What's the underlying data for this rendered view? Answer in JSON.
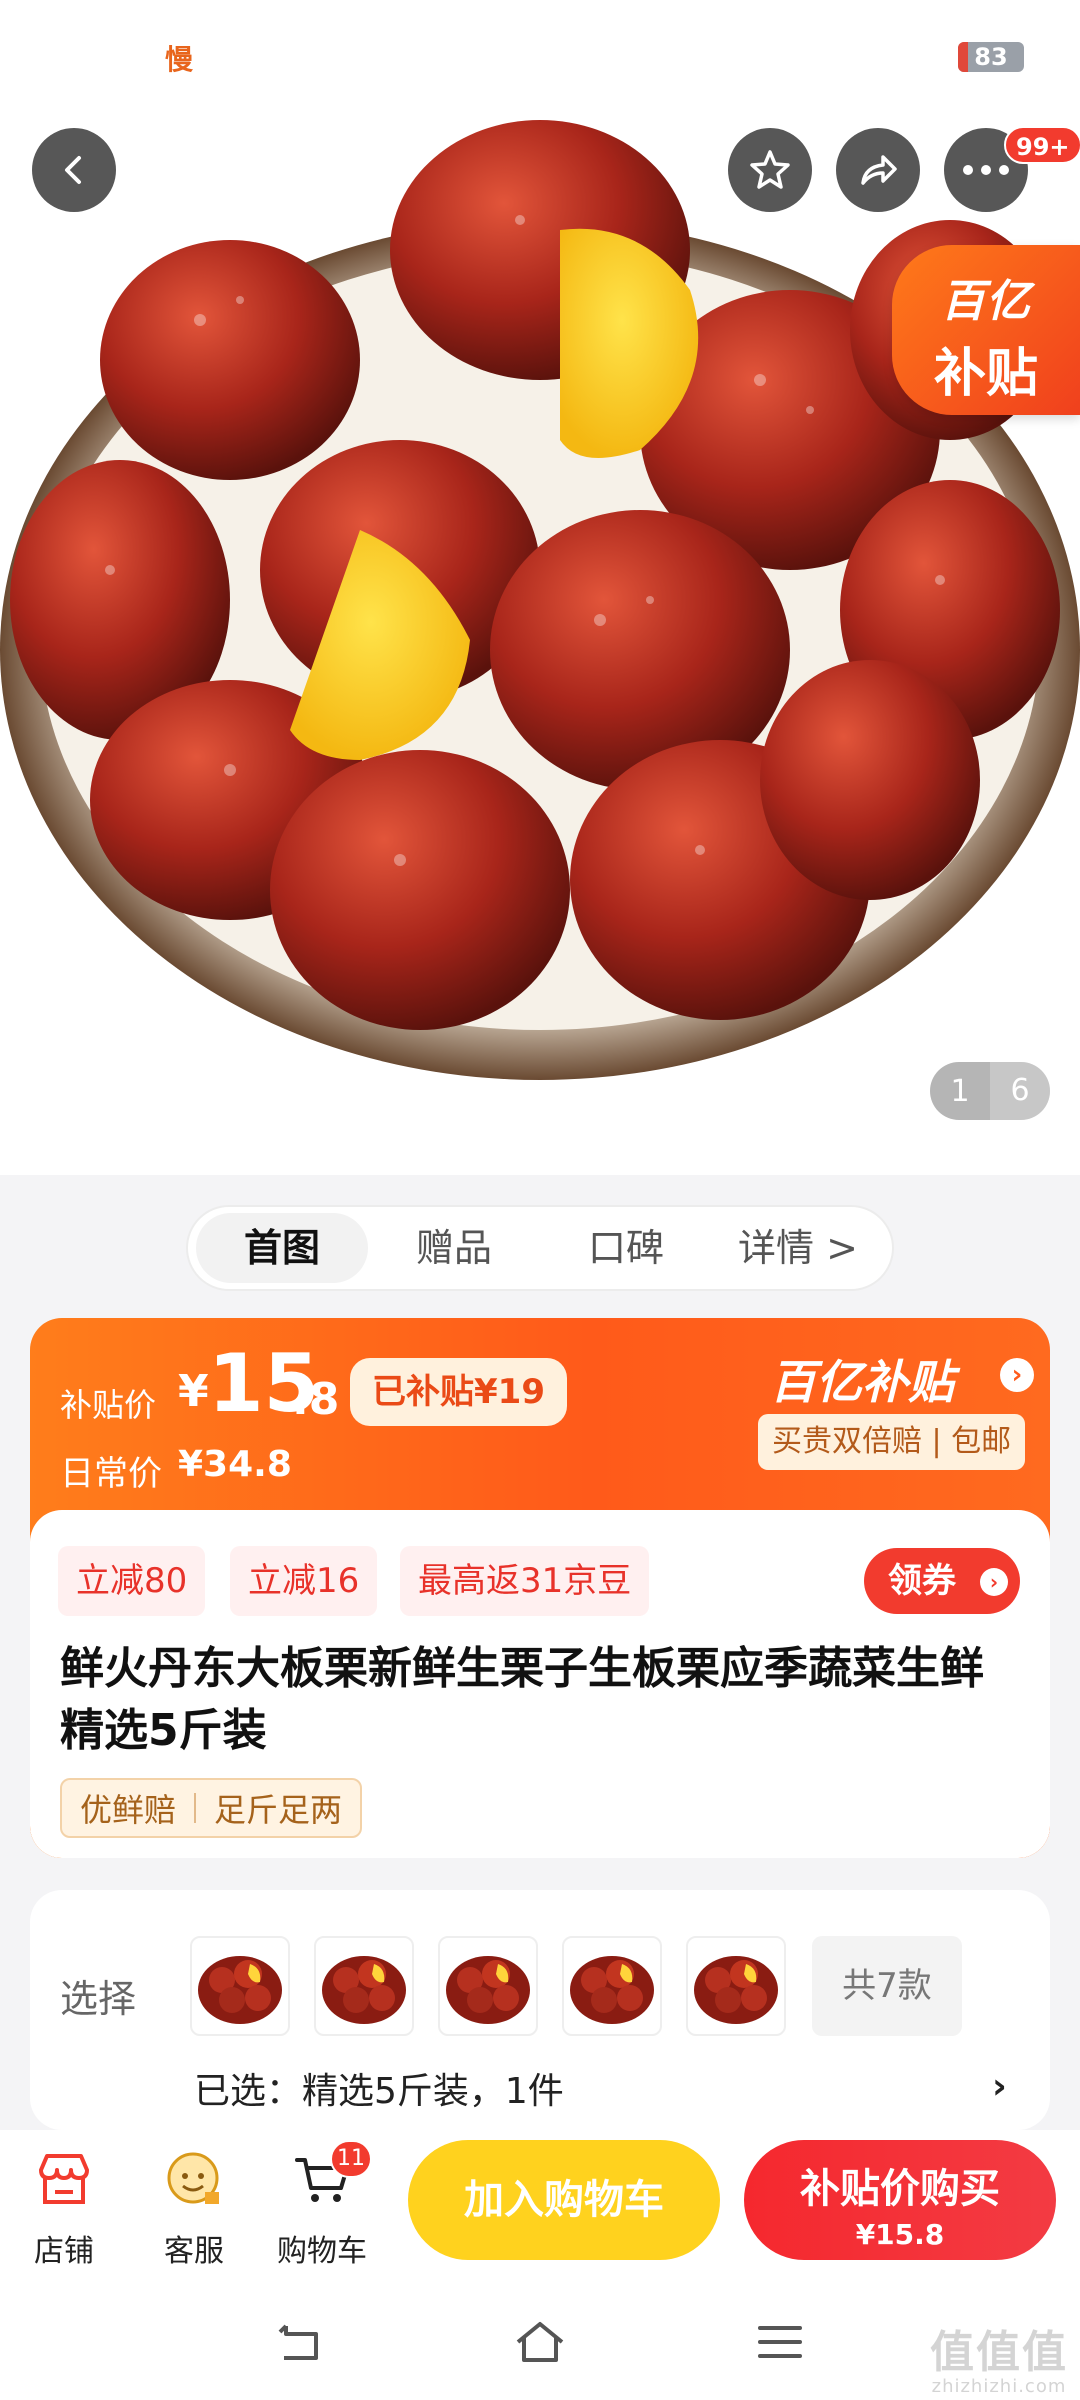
{
  "status_bar": {
    "left_text": "慢",
    "battery": "83"
  },
  "header": {
    "badge_count": "99+"
  },
  "hero": {
    "subsidy_line1": "百亿",
    "subsidy_line2": "补贴",
    "page_current": "1",
    "page_total": "6"
  },
  "tabs": [
    {
      "label": "首图"
    },
    {
      "label": "赠品"
    },
    {
      "label": "口碑"
    },
    {
      "label": "详情 >"
    }
  ],
  "price": {
    "label": "补贴价",
    "currency": "¥",
    "integer": "15",
    "decimal": ".8",
    "subsidized": "已补贴¥19",
    "daily_label": "日常价",
    "daily_value": "¥34.8",
    "brand": "百亿补贴",
    "guarantee": "买贵双倍赔 | 包邮"
  },
  "promos": {
    "chips": [
      "立减80",
      "立减16",
      "最高返31京豆"
    ],
    "coupon": "领券"
  },
  "product": {
    "title": "鲜火丹东大板栗新鲜生栗子生板栗应季蔬菜生鲜 精选5斤装",
    "tags": [
      "优鲜赔",
      "足斤足两"
    ]
  },
  "selection": {
    "label": "选择",
    "more_styles": "共7款",
    "selected": "已选：精选5斤装，1件"
  },
  "bottom_bar": {
    "store": "店铺",
    "service": "客服",
    "cart": "购物车",
    "cart_count": "11",
    "add_to_cart": "加入购物车",
    "buy_label": "补贴价购买",
    "buy_price": "¥15.8"
  },
  "watermark": {
    "main": "值值值",
    "sub": "zhizhizhi.com"
  },
  "colors": {
    "accent_orange": "#ff5a1a",
    "accent_red": "#f23b2e",
    "yellow_button": "#ffd21e"
  }
}
